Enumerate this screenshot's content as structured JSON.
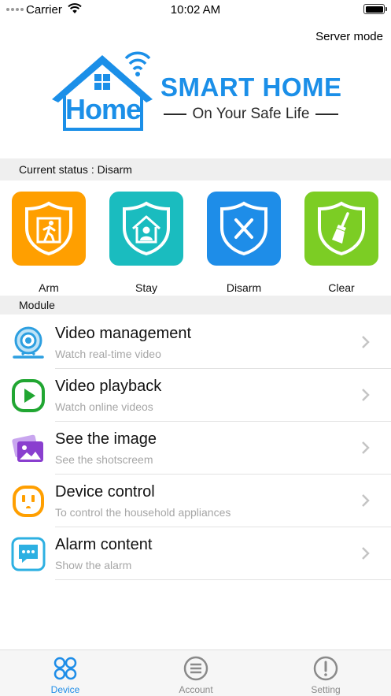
{
  "status_bar": {
    "carrier": "Carrier",
    "time": "10:02 AM"
  },
  "header": {
    "server_mode_label": "Server mode",
    "logo": {
      "badge_text": "Home",
      "title": "SMART HOME",
      "tagline": "On Your Safe Life"
    }
  },
  "current_status": {
    "label": "Current status : Disarm"
  },
  "actions": [
    {
      "label": "Arm",
      "color": "#ff9f00",
      "icon": "runner-shield-icon"
    },
    {
      "label": "Stay",
      "color": "#1abcbf",
      "icon": "home-person-shield-icon"
    },
    {
      "label": "Disarm",
      "color": "#1e8de8",
      "icon": "x-shield-icon"
    },
    {
      "label": "Clear",
      "color": "#7ccd24",
      "icon": "broom-shield-icon"
    }
  ],
  "module": {
    "label": "Module",
    "items": [
      {
        "title": "Video management",
        "subtitle": "Watch real-time video",
        "icon": "camera-icon",
        "color": "#2d9fe0"
      },
      {
        "title": "Video playback",
        "subtitle": "Watch online videos",
        "icon": "play-icon",
        "color": "#21a632"
      },
      {
        "title": "See the image",
        "subtitle": "See the shotscreem",
        "icon": "image-icon",
        "color": "#8a3fcf"
      },
      {
        "title": "Device control",
        "subtitle": "To control the household appliances",
        "icon": "outlet-icon",
        "color": "#ff9f00"
      },
      {
        "title": "Alarm content",
        "subtitle": "Show the alarm",
        "icon": "message-icon",
        "color": "#2db0e2"
      }
    ]
  },
  "tabbar": {
    "tabs": [
      {
        "label": "Device",
        "active": true,
        "icon": "grid-circles-icon"
      },
      {
        "label": "Account",
        "active": false,
        "icon": "list-circle-icon"
      },
      {
        "label": "Setting",
        "active": false,
        "icon": "alert-circle-icon"
      }
    ],
    "active_color": "#1e8de8",
    "inactive_color": "#8a8a8a"
  }
}
